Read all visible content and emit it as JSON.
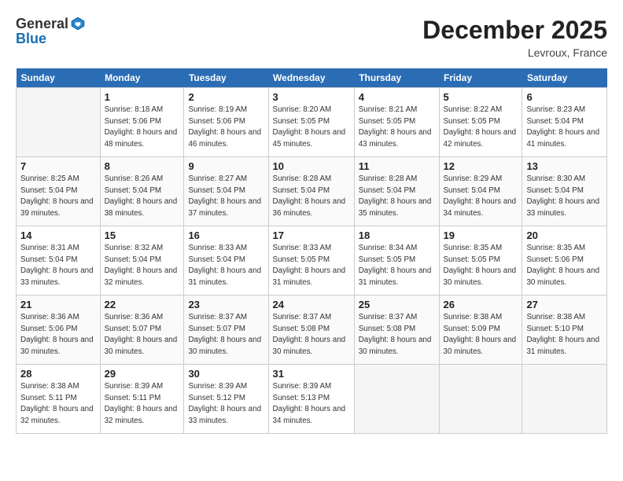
{
  "header": {
    "logo_general": "General",
    "logo_blue": "Blue",
    "title": "December 2025",
    "location": "Levroux, France"
  },
  "columns": [
    "Sunday",
    "Monday",
    "Tuesday",
    "Wednesday",
    "Thursday",
    "Friday",
    "Saturday"
  ],
  "weeks": [
    [
      {
        "day": "",
        "sunrise": "",
        "sunset": "",
        "daylight": ""
      },
      {
        "day": "1",
        "sunrise": "Sunrise: 8:18 AM",
        "sunset": "Sunset: 5:06 PM",
        "daylight": "Daylight: 8 hours and 48 minutes."
      },
      {
        "day": "2",
        "sunrise": "Sunrise: 8:19 AM",
        "sunset": "Sunset: 5:06 PM",
        "daylight": "Daylight: 8 hours and 46 minutes."
      },
      {
        "day": "3",
        "sunrise": "Sunrise: 8:20 AM",
        "sunset": "Sunset: 5:05 PM",
        "daylight": "Daylight: 8 hours and 45 minutes."
      },
      {
        "day": "4",
        "sunrise": "Sunrise: 8:21 AM",
        "sunset": "Sunset: 5:05 PM",
        "daylight": "Daylight: 8 hours and 43 minutes."
      },
      {
        "day": "5",
        "sunrise": "Sunrise: 8:22 AM",
        "sunset": "Sunset: 5:05 PM",
        "daylight": "Daylight: 8 hours and 42 minutes."
      },
      {
        "day": "6",
        "sunrise": "Sunrise: 8:23 AM",
        "sunset": "Sunset: 5:04 PM",
        "daylight": "Daylight: 8 hours and 41 minutes."
      }
    ],
    [
      {
        "day": "7",
        "sunrise": "Sunrise: 8:25 AM",
        "sunset": "Sunset: 5:04 PM",
        "daylight": "Daylight: 8 hours and 39 minutes."
      },
      {
        "day": "8",
        "sunrise": "Sunrise: 8:26 AM",
        "sunset": "Sunset: 5:04 PM",
        "daylight": "Daylight: 8 hours and 38 minutes."
      },
      {
        "day": "9",
        "sunrise": "Sunrise: 8:27 AM",
        "sunset": "Sunset: 5:04 PM",
        "daylight": "Daylight: 8 hours and 37 minutes."
      },
      {
        "day": "10",
        "sunrise": "Sunrise: 8:28 AM",
        "sunset": "Sunset: 5:04 PM",
        "daylight": "Daylight: 8 hours and 36 minutes."
      },
      {
        "day": "11",
        "sunrise": "Sunrise: 8:28 AM",
        "sunset": "Sunset: 5:04 PM",
        "daylight": "Daylight: 8 hours and 35 minutes."
      },
      {
        "day": "12",
        "sunrise": "Sunrise: 8:29 AM",
        "sunset": "Sunset: 5:04 PM",
        "daylight": "Daylight: 8 hours and 34 minutes."
      },
      {
        "day": "13",
        "sunrise": "Sunrise: 8:30 AM",
        "sunset": "Sunset: 5:04 PM",
        "daylight": "Daylight: 8 hours and 33 minutes."
      }
    ],
    [
      {
        "day": "14",
        "sunrise": "Sunrise: 8:31 AM",
        "sunset": "Sunset: 5:04 PM",
        "daylight": "Daylight: 8 hours and 33 minutes."
      },
      {
        "day": "15",
        "sunrise": "Sunrise: 8:32 AM",
        "sunset": "Sunset: 5:04 PM",
        "daylight": "Daylight: 8 hours and 32 minutes."
      },
      {
        "day": "16",
        "sunrise": "Sunrise: 8:33 AM",
        "sunset": "Sunset: 5:04 PM",
        "daylight": "Daylight: 8 hours and 31 minutes."
      },
      {
        "day": "17",
        "sunrise": "Sunrise: 8:33 AM",
        "sunset": "Sunset: 5:05 PM",
        "daylight": "Daylight: 8 hours and 31 minutes."
      },
      {
        "day": "18",
        "sunrise": "Sunrise: 8:34 AM",
        "sunset": "Sunset: 5:05 PM",
        "daylight": "Daylight: 8 hours and 31 minutes."
      },
      {
        "day": "19",
        "sunrise": "Sunrise: 8:35 AM",
        "sunset": "Sunset: 5:05 PM",
        "daylight": "Daylight: 8 hours and 30 minutes."
      },
      {
        "day": "20",
        "sunrise": "Sunrise: 8:35 AM",
        "sunset": "Sunset: 5:06 PM",
        "daylight": "Daylight: 8 hours and 30 minutes."
      }
    ],
    [
      {
        "day": "21",
        "sunrise": "Sunrise: 8:36 AM",
        "sunset": "Sunset: 5:06 PM",
        "daylight": "Daylight: 8 hours and 30 minutes."
      },
      {
        "day": "22",
        "sunrise": "Sunrise: 8:36 AM",
        "sunset": "Sunset: 5:07 PM",
        "daylight": "Daylight: 8 hours and 30 minutes."
      },
      {
        "day": "23",
        "sunrise": "Sunrise: 8:37 AM",
        "sunset": "Sunset: 5:07 PM",
        "daylight": "Daylight: 8 hours and 30 minutes."
      },
      {
        "day": "24",
        "sunrise": "Sunrise: 8:37 AM",
        "sunset": "Sunset: 5:08 PM",
        "daylight": "Daylight: 8 hours and 30 minutes."
      },
      {
        "day": "25",
        "sunrise": "Sunrise: 8:37 AM",
        "sunset": "Sunset: 5:08 PM",
        "daylight": "Daylight: 8 hours and 30 minutes."
      },
      {
        "day": "26",
        "sunrise": "Sunrise: 8:38 AM",
        "sunset": "Sunset: 5:09 PM",
        "daylight": "Daylight: 8 hours and 30 minutes."
      },
      {
        "day": "27",
        "sunrise": "Sunrise: 8:38 AM",
        "sunset": "Sunset: 5:10 PM",
        "daylight": "Daylight: 8 hours and 31 minutes."
      }
    ],
    [
      {
        "day": "28",
        "sunrise": "Sunrise: 8:38 AM",
        "sunset": "Sunset: 5:11 PM",
        "daylight": "Daylight: 8 hours and 32 minutes."
      },
      {
        "day": "29",
        "sunrise": "Sunrise: 8:39 AM",
        "sunset": "Sunset: 5:11 PM",
        "daylight": "Daylight: 8 hours and 32 minutes."
      },
      {
        "day": "30",
        "sunrise": "Sunrise: 8:39 AM",
        "sunset": "Sunset: 5:12 PM",
        "daylight": "Daylight: 8 hours and 33 minutes."
      },
      {
        "day": "31",
        "sunrise": "Sunrise: 8:39 AM",
        "sunset": "Sunset: 5:13 PM",
        "daylight": "Daylight: 8 hours and 34 minutes."
      },
      {
        "day": "",
        "sunrise": "",
        "sunset": "",
        "daylight": ""
      },
      {
        "day": "",
        "sunrise": "",
        "sunset": "",
        "daylight": ""
      },
      {
        "day": "",
        "sunrise": "",
        "sunset": "",
        "daylight": ""
      }
    ]
  ]
}
